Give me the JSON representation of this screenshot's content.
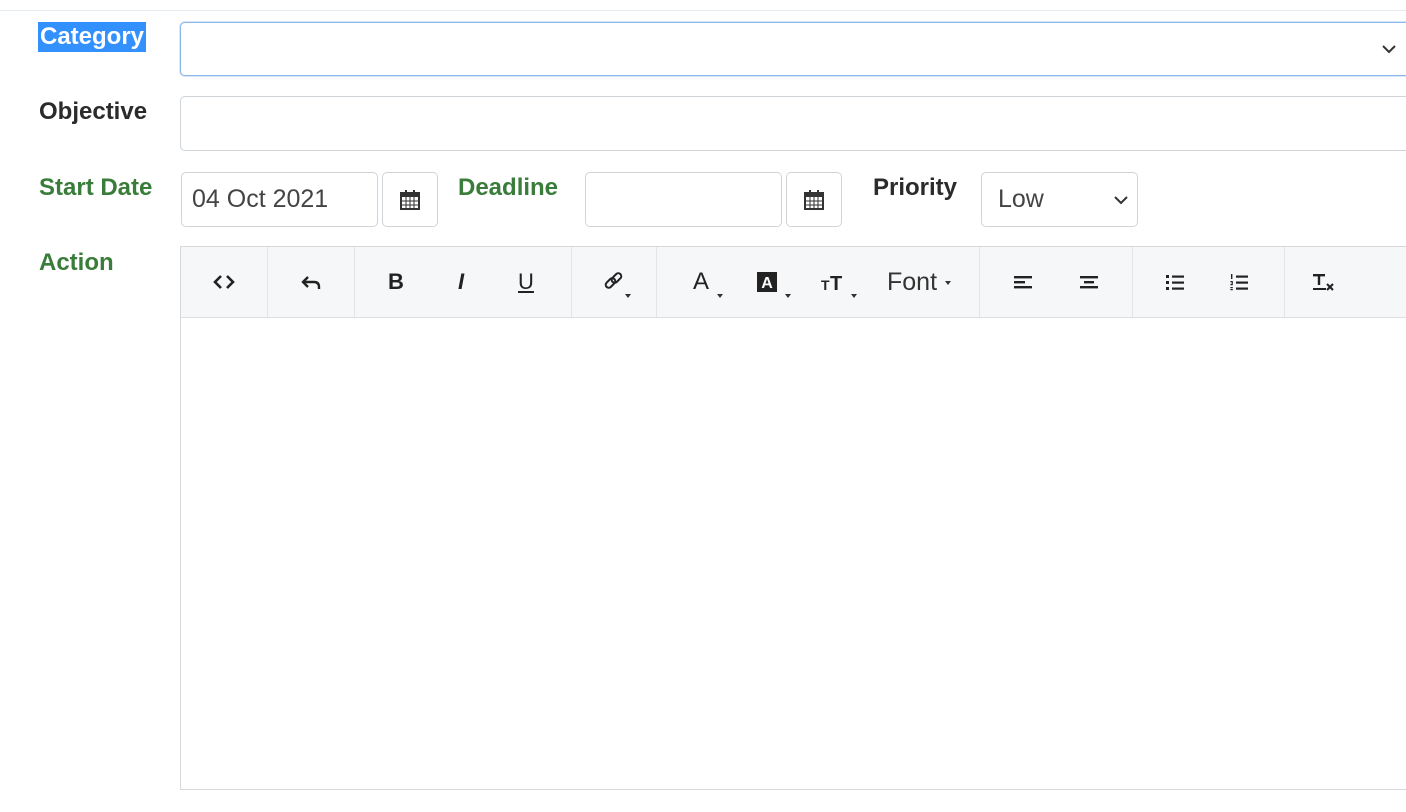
{
  "form": {
    "category": {
      "label": "Category",
      "value": ""
    },
    "objective": {
      "label": "Objective",
      "value": ""
    },
    "start_date": {
      "label": "Start Date",
      "value": "04 Oct 2021"
    },
    "deadline": {
      "label": "Deadline",
      "value": ""
    },
    "priority": {
      "label": "Priority",
      "value": "Low"
    },
    "action": {
      "label": "Action"
    }
  },
  "editor": {
    "font_label": "Font",
    "tools": [
      "code-view",
      "undo",
      "bold",
      "italic",
      "underline",
      "link",
      "font-color",
      "highlight-color",
      "font-size",
      "font",
      "align-left",
      "align-center",
      "unordered-list",
      "ordered-list",
      "clear-formatting"
    ],
    "bold_glyph": "B",
    "italic_glyph": "I",
    "underline_glyph": "U"
  },
  "colors": {
    "label_green": "#3a7d3a",
    "highlight": "#3390ff"
  }
}
